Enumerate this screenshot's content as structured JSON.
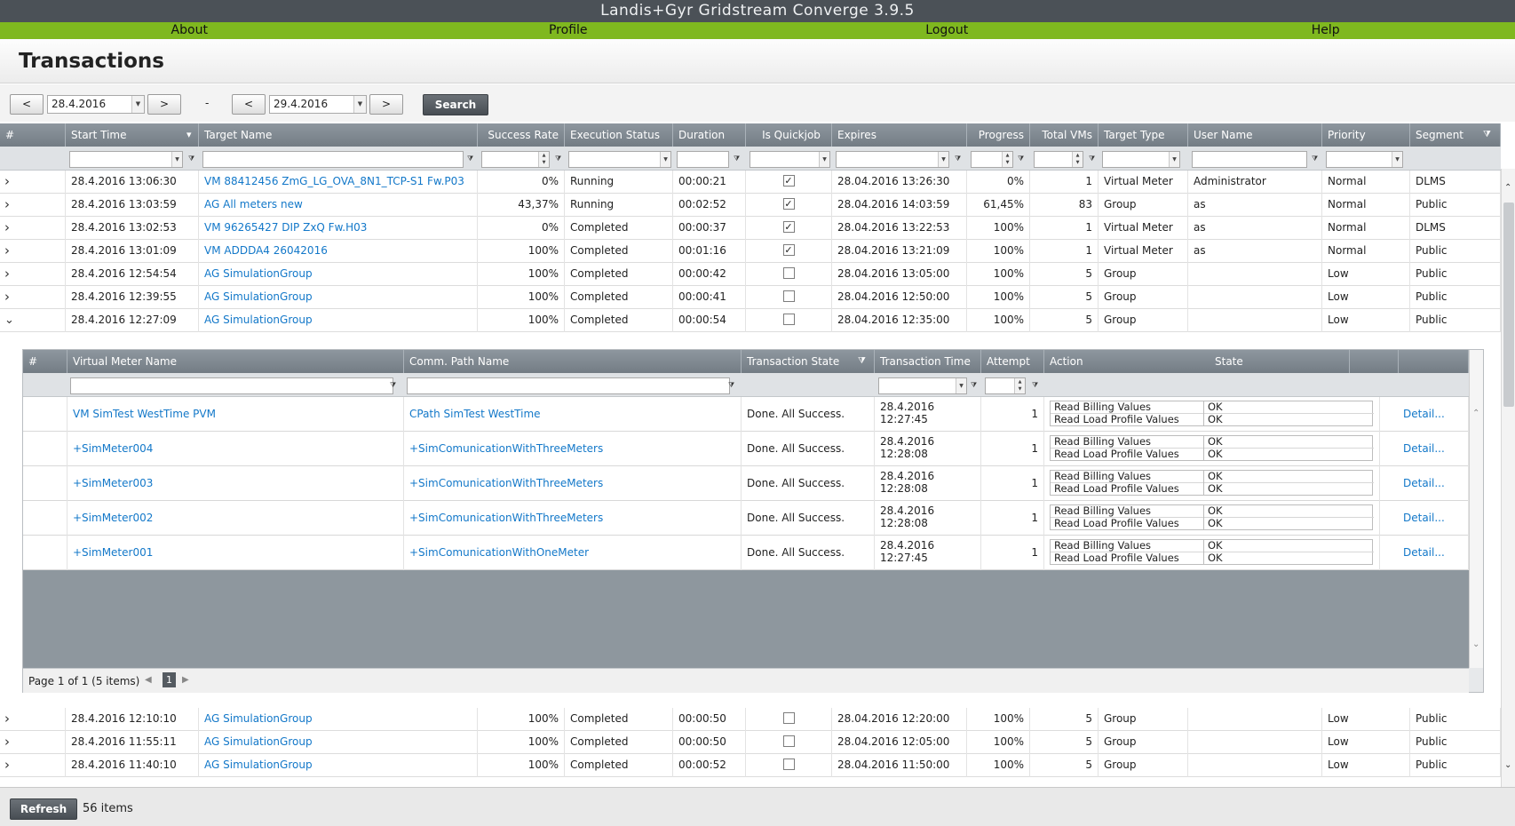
{
  "app": {
    "title": "Landis+Gyr Gridstream Converge  3.9.5"
  },
  "menu": [
    "About",
    "Profile",
    "Logout",
    "Help"
  ],
  "page": {
    "title": "Transactions"
  },
  "toolbar": {
    "prev_label": "<",
    "next_label": ">",
    "from_date": "28.4.2016",
    "to_date": "29.4.2016",
    "dash": "-",
    "search_label": "Search"
  },
  "columns": [
    "#",
    "Start Time",
    "Target Name",
    "Success Rate",
    "Execution Status",
    "Duration",
    "Is Quickjob",
    "Expires",
    "Progress",
    "Total VMs",
    "Target Type",
    "User Name",
    "Priority",
    "Segment"
  ],
  "rows_top": [
    {
      "start": "28.4.2016 13:06:30",
      "target": "VM 88412456 ZmG_LG_OVA_8N1_TCP-S1 Fw.P03",
      "rate": "0%",
      "status": "Running",
      "duration": "00:00:21",
      "quick": true,
      "expires": "28.04.2016 13:26:30",
      "progress": "0%",
      "vms": "1",
      "type": "Virtual Meter",
      "user": "Administrator",
      "priority": "Normal",
      "segment": "DLMS",
      "expanded": false
    },
    {
      "start": "28.4.2016 13:03:59",
      "target": "AG All meters new",
      "rate": "43,37%",
      "status": "Running",
      "duration": "00:02:52",
      "quick": true,
      "expires": "28.04.2016 14:03:59",
      "progress": "61,45%",
      "vms": "83",
      "type": "Group",
      "user": "as",
      "priority": "Normal",
      "segment": "Public",
      "expanded": false
    },
    {
      "start": "28.4.2016 13:02:53",
      "target": "VM 96265427 DIP ZxQ Fw.H03",
      "rate": "0%",
      "status": "Completed",
      "duration": "00:00:37",
      "quick": true,
      "expires": "28.04.2016 13:22:53",
      "progress": "100%",
      "vms": "1",
      "type": "Virtual Meter",
      "user": "as",
      "priority": "Normal",
      "segment": "DLMS",
      "expanded": false
    },
    {
      "start": "28.4.2016 13:01:09",
      "target": "VM ADDDA4 26042016",
      "rate": "100%",
      "status": "Completed",
      "duration": "00:01:16",
      "quick": true,
      "expires": "28.04.2016 13:21:09",
      "progress": "100%",
      "vms": "1",
      "type": "Virtual Meter",
      "user": "as",
      "priority": "Normal",
      "segment": "Public",
      "expanded": false
    },
    {
      "start": "28.4.2016 12:54:54",
      "target": "AG SimulationGroup",
      "rate": "100%",
      "status": "Completed",
      "duration": "00:00:42",
      "quick": false,
      "expires": "28.04.2016 13:05:00",
      "progress": "100%",
      "vms": "5",
      "type": "Group",
      "user": "",
      "priority": "Low",
      "segment": "Public",
      "expanded": false
    },
    {
      "start": "28.4.2016 12:39:55",
      "target": "AG SimulationGroup",
      "rate": "100%",
      "status": "Completed",
      "duration": "00:00:41",
      "quick": false,
      "expires": "28.04.2016 12:50:00",
      "progress": "100%",
      "vms": "5",
      "type": "Group",
      "user": "",
      "priority": "Low",
      "segment": "Public",
      "expanded": false
    },
    {
      "start": "28.4.2016 12:27:09",
      "target": "AG SimulationGroup",
      "rate": "100%",
      "status": "Completed",
      "duration": "00:00:54",
      "quick": false,
      "expires": "28.04.2016 12:35:00",
      "progress": "100%",
      "vms": "5",
      "type": "Group",
      "user": "",
      "priority": "Low",
      "segment": "Public",
      "expanded": true
    }
  ],
  "rows_bottom": [
    {
      "start": "28.4.2016 12:10:10",
      "target": "AG SimulationGroup",
      "rate": "100%",
      "status": "Completed",
      "duration": "00:00:50",
      "quick": false,
      "expires": "28.04.2016 12:20:00",
      "progress": "100%",
      "vms": "5",
      "type": "Group",
      "user": "",
      "priority": "Low",
      "segment": "Public",
      "expanded": false
    },
    {
      "start": "28.4.2016 11:55:11",
      "target": "AG SimulationGroup",
      "rate": "100%",
      "status": "Completed",
      "duration": "00:00:50",
      "quick": false,
      "expires": "28.04.2016 12:05:00",
      "progress": "100%",
      "vms": "5",
      "type": "Group",
      "user": "",
      "priority": "Low",
      "segment": "Public",
      "expanded": false
    },
    {
      "start": "28.4.2016 11:40:10",
      "target": "AG SimulationGroup",
      "rate": "100%",
      "status": "Completed",
      "duration": "00:00:52",
      "quick": false,
      "expires": "28.04.2016 11:50:00",
      "progress": "100%",
      "vms": "5",
      "type": "Group",
      "user": "",
      "priority": "Low",
      "segment": "Public",
      "expanded": false
    }
  ],
  "detail": {
    "columns": [
      "#",
      "Virtual Meter Name",
      "Comm. Path Name",
      "Transaction State",
      "Transaction Time",
      "Attempt",
      "Action",
      "State"
    ],
    "rows": [
      {
        "vm": "VM SimTest WestTime PVM",
        "path": "CPath SimTest WestTime",
        "state": "Done. All Success.",
        "date": "28.4.2016",
        "time": "12:27:45",
        "attempt": "1",
        "actions": [
          {
            "a": "Read Billing Values",
            "s": "OK"
          },
          {
            "a": "Read Load Profile Values",
            "s": "OK"
          }
        ],
        "detail_label": "Detail..."
      },
      {
        "vm": "+SimMeter004",
        "path": "+SimComunicationWithThreeMeters",
        "state": "Done. All Success.",
        "date": "28.4.2016",
        "time": "12:28:08",
        "attempt": "1",
        "actions": [
          {
            "a": "Read Billing Values",
            "s": "OK"
          },
          {
            "a": "Read Load Profile Values",
            "s": "OK"
          }
        ],
        "detail_label": "Detail..."
      },
      {
        "vm": "+SimMeter003",
        "path": "+SimComunicationWithThreeMeters",
        "state": "Done. All Success.",
        "date": "28.4.2016",
        "time": "12:28:08",
        "attempt": "1",
        "actions": [
          {
            "a": "Read Billing Values",
            "s": "OK"
          },
          {
            "a": "Read Load Profile Values",
            "s": "OK"
          }
        ],
        "detail_label": "Detail..."
      },
      {
        "vm": "+SimMeter002",
        "path": "+SimComunicationWithThreeMeters",
        "state": "Done. All Success.",
        "date": "28.4.2016",
        "time": "12:28:08",
        "attempt": "1",
        "actions": [
          {
            "a": "Read Billing Values",
            "s": "OK"
          },
          {
            "a": "Read Load Profile Values",
            "s": "OK"
          }
        ],
        "detail_label": "Detail..."
      },
      {
        "vm": "+SimMeter001",
        "path": "+SimComunicationWithOneMeter",
        "state": "Done. All Success.",
        "date": "28.4.2016",
        "time": "12:27:45",
        "attempt": "1",
        "actions": [
          {
            "a": "Read Billing Values",
            "s": "OK"
          },
          {
            "a": "Read Load Profile Values",
            "s": "OK"
          }
        ],
        "detail_label": "Detail..."
      }
    ],
    "pager_text": "Page 1 of 1 (5 items)",
    "page_number": "1"
  },
  "footer": {
    "refresh_label": "Refresh",
    "items_count": "56 items"
  },
  "colors": {
    "titlebar": "#4b5157",
    "menubar": "#7fb81f",
    "header": "#80898f",
    "link": "#1378c9"
  }
}
